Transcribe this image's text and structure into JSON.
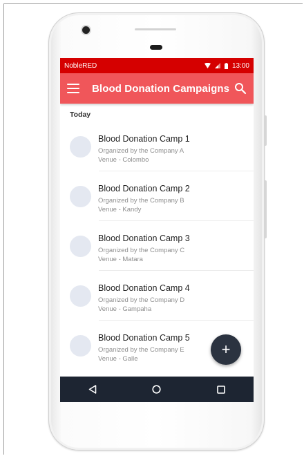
{
  "status_bar": {
    "carrier": "NobleRED",
    "time": "13:00"
  },
  "app_bar": {
    "title": "Blood Donation Campaigns",
    "menu_icon": "hamburger-menu-icon",
    "search_icon": "search-icon",
    "color": "#f0565a"
  },
  "status_bar_color": "#d50000",
  "section_header": "Today",
  "campaigns": [
    {
      "title": "Blood Donation Camp 1",
      "organizer": "Organized by the Company A",
      "venue": "Venue - Colombo"
    },
    {
      "title": "Blood Donation Camp 2",
      "organizer": "Organized by the Company B",
      "venue": "Venue - Kandy"
    },
    {
      "title": "Blood Donation Camp 3",
      "organizer": "Organized by the Company C",
      "venue": "Venue - Matara"
    },
    {
      "title": "Blood Donation Camp 4",
      "organizer": "Organized by the Company D",
      "venue": "Venue - Gampaha"
    },
    {
      "title": "Blood Donation Camp 5",
      "organizer": "Organized by the Company E",
      "venue": "Venue - Galle"
    }
  ],
  "fab": {
    "label": "+",
    "icon": "add-icon",
    "color": "#2b3340"
  },
  "nav_bar": {
    "back_icon": "back-triangle-icon",
    "home_icon": "home-circle-icon",
    "recents_icon": "recents-square-icon",
    "color": "#1d2532"
  }
}
